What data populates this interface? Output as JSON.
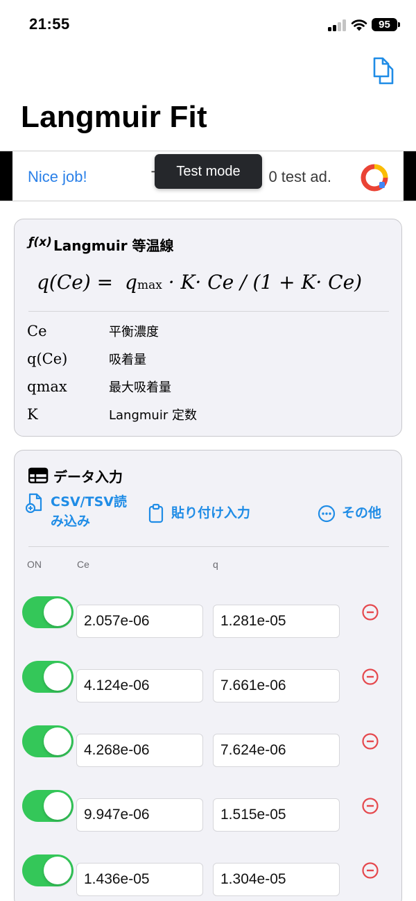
{
  "status_bar": {
    "time": "21:55",
    "battery": "95"
  },
  "header": {
    "title": "Langmuir Fit",
    "copy_icon": "copy-icon"
  },
  "ad": {
    "headline": "Nice job!",
    "body_start": "T",
    "body_end": "0 test ad.",
    "overlay": "Test mode"
  },
  "formula_card": {
    "icon": "function-icon",
    "icon_text": "ƒ(x)",
    "title": "Langmuir 等温線",
    "formula": {
      "lhs": "q(Ce) = ",
      "q": "q",
      "q_sub": "max",
      "rest": " · K· Ce / (1 + K· Ce)"
    },
    "definitions": [
      {
        "symbol": "Ce",
        "description": "平衡濃度"
      },
      {
        "symbol": "q(Ce)",
        "description": "吸着量"
      },
      {
        "symbol": "qmax",
        "description": "最大吸着量"
      },
      {
        "symbol": "K",
        "description": "Langmuir 定数"
      }
    ]
  },
  "data_card": {
    "icon": "table-icon",
    "title": "データ入力",
    "actions": [
      {
        "icon": "file-import-icon",
        "label_line1": "CSV/TSV読",
        "label_line2": "み込み"
      },
      {
        "icon": "clipboard-icon",
        "label": "貼り付け入力"
      },
      {
        "icon": "more-icon",
        "label": "その他"
      }
    ],
    "columns": {
      "on": "ON",
      "ce": "Ce",
      "q": "q"
    },
    "rows": [
      {
        "on": true,
        "ce": "2.057e-06",
        "q": "1.281e-05"
      },
      {
        "on": true,
        "ce": "4.124e-06",
        "q": "7.661e-06"
      },
      {
        "on": true,
        "ce": "4.268e-06",
        "q": "7.624e-06"
      },
      {
        "on": true,
        "ce": "9.947e-06",
        "q": "1.515e-05"
      },
      {
        "on": true,
        "ce": "1.436e-05",
        "q": "1.304e-05"
      }
    ]
  },
  "colors": {
    "accent": "#1f8ce6",
    "toggle_on": "#34c759",
    "remove": "#e5484d"
  }
}
